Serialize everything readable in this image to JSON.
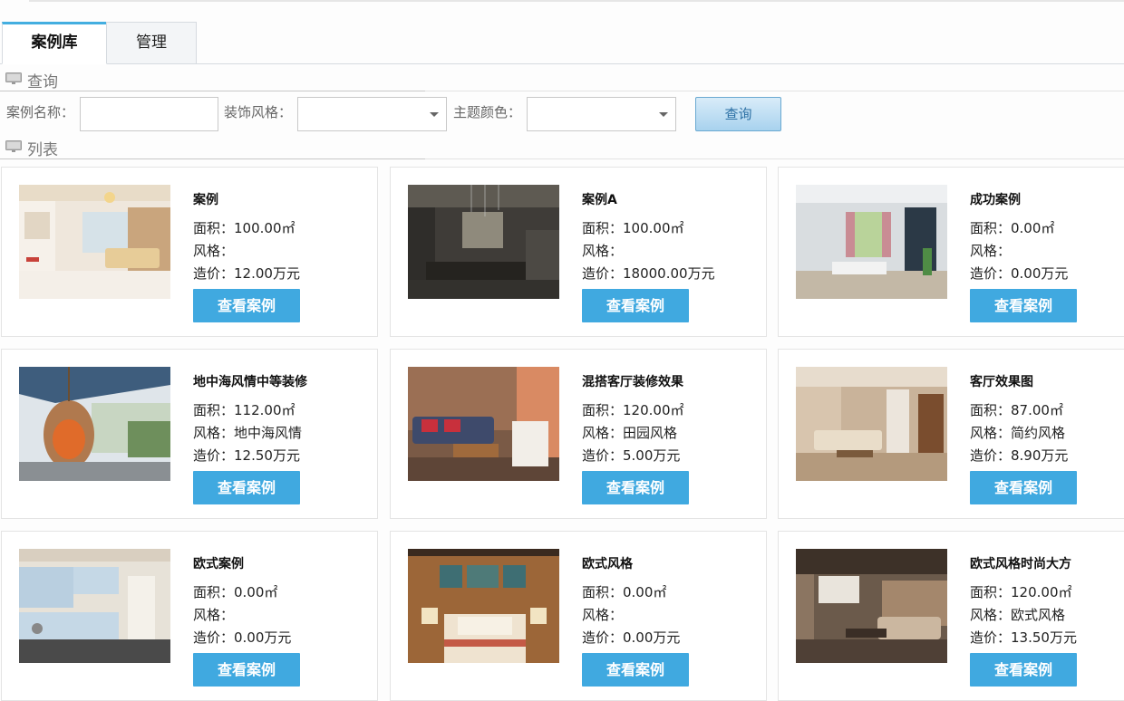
{
  "tabs": [
    {
      "label": "案例库",
      "active": true
    },
    {
      "label": "管理",
      "active": false
    }
  ],
  "sections": {
    "query": "查询",
    "list": "列表"
  },
  "search": {
    "name_label": "案例名称：",
    "name_value": "",
    "style_label": "装饰风格：",
    "style_value": "",
    "color_label": "主题颜色：",
    "color_value": "",
    "button": "查询"
  },
  "cases": [
    {
      "title": "案例",
      "area": "面积：100.00㎡",
      "style": "风格：",
      "price": "造价：12.00万元",
      "button": "查看案例"
    },
    {
      "title": "案例A",
      "area": "面积：100.00㎡",
      "style": "风格：",
      "price": "造价：18000.00万元",
      "button": "查看案例"
    },
    {
      "title": "成功案例",
      "area": "面积：0.00㎡",
      "style": "风格：",
      "price": "造价：0.00万元",
      "button": "查看案例"
    },
    {
      "title": "地中海风情中等装修",
      "area": "面积：112.00㎡",
      "style": "风格：地中海风情",
      "price": "造价：12.50万元",
      "button": "查看案例"
    },
    {
      "title": "混搭客厅装修效果",
      "area": "面积：120.00㎡",
      "style": "风格：田园风格",
      "price": "造价：5.00万元",
      "button": "查看案例"
    },
    {
      "title": "客厅效果图",
      "area": "面积：87.00㎡",
      "style": "风格：简约风格",
      "price": "造价：8.90万元",
      "button": "查看案例"
    },
    {
      "title": "欧式案例",
      "area": "面积：0.00㎡",
      "style": "风格：",
      "price": "造价：0.00万元",
      "button": "查看案例"
    },
    {
      "title": "欧式风格",
      "area": "面积：0.00㎡",
      "style": "风格：",
      "price": "造价：0.00万元",
      "button": "查看案例"
    },
    {
      "title": "欧式风格时尚大方",
      "area": "面积：120.00㎡",
      "style": "风格：欧式风格",
      "price": "造价：13.50万元",
      "button": "查看案例"
    }
  ],
  "colors": {
    "accent": "#40a9e0",
    "tab_active_top": "#43aee0"
  }
}
